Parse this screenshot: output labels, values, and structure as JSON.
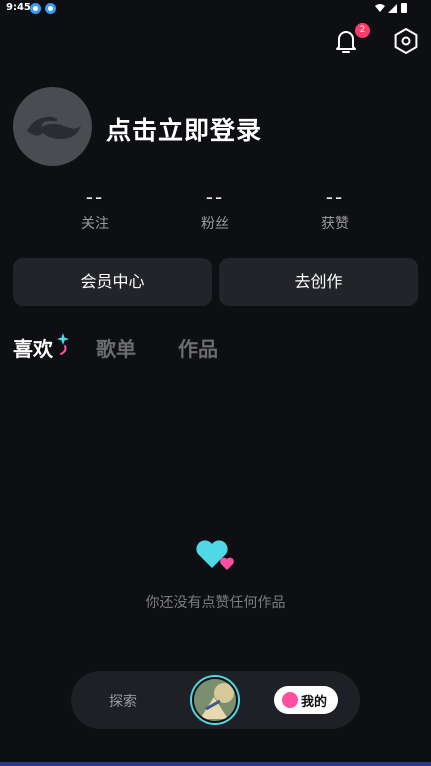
{
  "status_bar": {
    "time": "9:45"
  },
  "notifications": {
    "badge_count": "2"
  },
  "profile": {
    "login_prompt": "点击立即登录"
  },
  "stats": [
    {
      "value": "--",
      "label": "关注"
    },
    {
      "value": "--",
      "label": "粉丝"
    },
    {
      "value": "--",
      "label": "获赞"
    }
  ],
  "actions": {
    "vip_center": "会员中心",
    "go_create": "去创作"
  },
  "tabs": [
    {
      "label": "喜欢",
      "active": true
    },
    {
      "label": "歌单",
      "active": false
    },
    {
      "label": "作品",
      "active": false
    }
  ],
  "empty_state": {
    "message": "你还没有点赞任何作品"
  },
  "bottom_nav": {
    "explore": "探索",
    "mine": "我的"
  },
  "colors": {
    "background": "#0e0f12",
    "card": "#22242a",
    "accent_cyan": "#4fd9e6",
    "accent_pink": "#ff4fa0",
    "badge": "#ff3b6b"
  }
}
